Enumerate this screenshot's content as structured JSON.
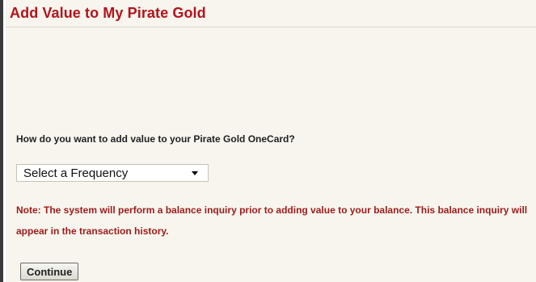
{
  "page": {
    "title": "Add Value to My Pirate Gold"
  },
  "form": {
    "question": "How do you want to add value to your Pirate Gold OneCard?",
    "frequency_select": {
      "selected": "Select a Frequency"
    },
    "note": "Note: The system will perform a balance inquiry prior to adding value to your balance. This balance inquiry will appear in the transaction history.",
    "continue_label": "Continue"
  },
  "colors": {
    "title": "#b5121b",
    "note": "#9b1b1b",
    "panel_background": "#f7f5ee"
  },
  "icons": {
    "select_arrow": "chevron-down-icon"
  }
}
